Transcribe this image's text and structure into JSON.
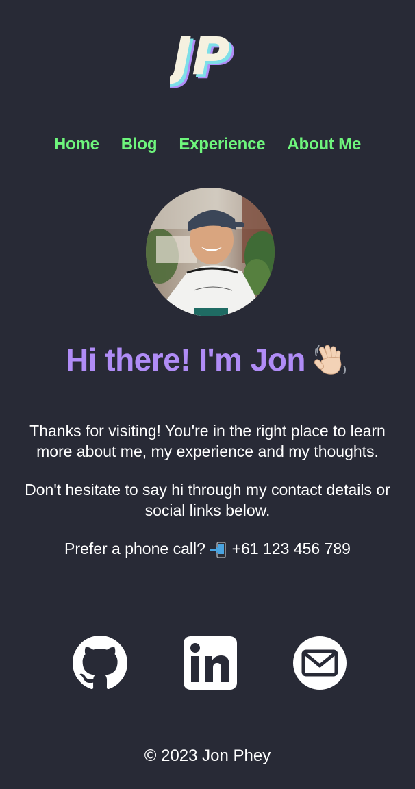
{
  "logo": {
    "text": "JP",
    "icon": "jp-logo"
  },
  "nav": {
    "items": [
      {
        "label": "Home"
      },
      {
        "label": "Blog"
      },
      {
        "label": "Experience"
      },
      {
        "label": "About Me"
      }
    ]
  },
  "avatar": {
    "icon": "profile-photo"
  },
  "headline": {
    "text": "Hi there! I'm Jon",
    "emoji": "waving-hand-icon"
  },
  "intro": {
    "para1": "Thanks for visiting! You're in the right place to learn more about me, my experience and my thoughts.",
    "para2": "Don't hesitate to say hi through my contact details or social links below.",
    "phone_prefix": "Prefer a phone call?",
    "phone_number": "+61 123 456 789",
    "phone_icon": "mobile-phone-arrow-icon"
  },
  "socials": {
    "items": [
      {
        "icon": "github-icon"
      },
      {
        "icon": "linkedin-icon"
      },
      {
        "icon": "email-icon"
      }
    ]
  },
  "footer": {
    "copyright": "© 2023 Jon Phey"
  },
  "colors": {
    "background": "#282a36",
    "nav_link": "#6ef57c",
    "headline": "#b08cf6",
    "text": "#ffffff"
  }
}
